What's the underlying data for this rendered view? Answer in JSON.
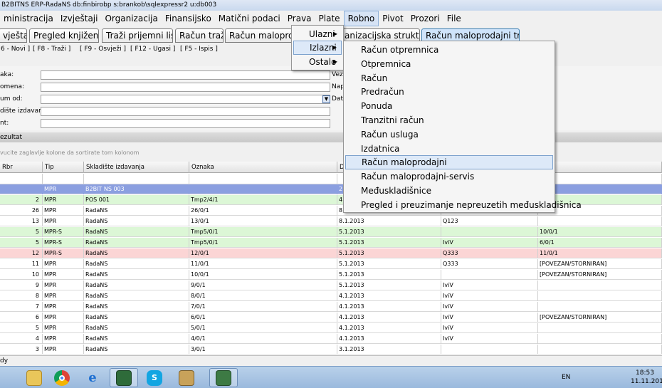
{
  "window": {
    "title": "B2BITNS ERP-RadaNS db:finbirobp s:brankob\\sqlexpressr2 u:db003"
  },
  "menubar": [
    "ministracija",
    "Izvještaji",
    "Organizacija",
    "Finansijsko",
    "Matični podaci",
    "Prava",
    "Plate",
    "Robno",
    "Pivot",
    "Prozori",
    "File"
  ],
  "tabs": [
    "vještaji",
    "Pregled knjiženja",
    "Traži prijemni list",
    "Račun traži",
    "Račun maloprodaj",
    "anizacijska struktura",
    "Račun maloprodajni traži"
  ],
  "shortcuts": [
    "6 - Novi ]",
    "[ F8 - Traži ]",
    "[ F9 - Osvježi ]",
    "[ F12 - Ugasi ]",
    "[ F5 - Ispis ]"
  ],
  "filter": {
    "labels": [
      "aka:",
      "omena:",
      "um od:",
      "dište izdavanja:",
      "nt:"
    ],
    "right_labels": [
      "Veza",
      "Napo",
      "Datu"
    ]
  },
  "section_label": "ezultat",
  "group_hint": "vucite zaglavlje kolone da sortirate tom kolonom",
  "grid": {
    "columns": [
      "Rbr",
      "Tip",
      "Skladište izdavanja",
      "Oznaka",
      "D",
      "",
      ""
    ],
    "rows": [
      {
        "rbr": "",
        "tip": "MPR",
        "skl": "B2BIT NS 003",
        "ozn": "",
        "dat": "2",
        "c6": "",
        "c7": "",
        "style": "sel"
      },
      {
        "rbr": "2",
        "tip": "MPR",
        "skl": "POS 001",
        "ozn": "Tmp2/4/1",
        "dat": "4",
        "c6": "",
        "c7": "",
        "style": "green"
      },
      {
        "rbr": "26",
        "tip": "MPR",
        "skl": "RadaNS",
        "ozn": "26/0/1",
        "dat": "8",
        "c6": "",
        "c7": "",
        "style": ""
      },
      {
        "rbr": "13",
        "tip": "MPR",
        "skl": "RadaNS",
        "ozn": "13/0/1",
        "dat": "8.1.2013",
        "c6": "Q123",
        "c7": "",
        "style": ""
      },
      {
        "rbr": "5",
        "tip": "MPR-S",
        "skl": "RadaNS",
        "ozn": "Tmp5/0/1",
        "dat": "5.1.2013",
        "c6": "",
        "c7": "10/0/1",
        "style": "green"
      },
      {
        "rbr": "5",
        "tip": "MPR-S",
        "skl": "RadaNS",
        "ozn": "Tmp5/0/1",
        "dat": "5.1.2013",
        "c6": "IviV",
        "c7": "6/0/1",
        "style": "green"
      },
      {
        "rbr": "12",
        "tip": "MPR-S",
        "skl": "RadaNS",
        "ozn": "12/0/1",
        "dat": "5.1.2013",
        "c6": "Q333",
        "c7": "11/0/1",
        "style": "red"
      },
      {
        "rbr": "11",
        "tip": "MPR",
        "skl": "RadaNS",
        "ozn": "11/0/1",
        "dat": "5.1.2013",
        "c6": "Q333",
        "c7": "[POVEZAN/STORNIRAN]",
        "style": ""
      },
      {
        "rbr": "10",
        "tip": "MPR",
        "skl": "RadaNS",
        "ozn": "10/0/1",
        "dat": "5.1.2013",
        "c6": "",
        "c7": "[POVEZAN/STORNIRAN]",
        "style": ""
      },
      {
        "rbr": "9",
        "tip": "MPR",
        "skl": "RadaNS",
        "ozn": "9/0/1",
        "dat": "5.1.2013",
        "c6": "IviV",
        "c7": "",
        "style": ""
      },
      {
        "rbr": "8",
        "tip": "MPR",
        "skl": "RadaNS",
        "ozn": "8/0/1",
        "dat": "4.1.2013",
        "c6": "IviV",
        "c7": "",
        "style": ""
      },
      {
        "rbr": "7",
        "tip": "MPR",
        "skl": "RadaNS",
        "ozn": "7/0/1",
        "dat": "4.1.2013",
        "c6": "IviV",
        "c7": "",
        "style": ""
      },
      {
        "rbr": "6",
        "tip": "MPR",
        "skl": "RadaNS",
        "ozn": "6/0/1",
        "dat": "4.1.2013",
        "c6": "IviV",
        "c7": "[POVEZAN/STORNIRAN]",
        "style": ""
      },
      {
        "rbr": "5",
        "tip": "MPR",
        "skl": "RadaNS",
        "ozn": "5/0/1",
        "dat": "4.1.2013",
        "c6": "IviV",
        "c7": "",
        "style": ""
      },
      {
        "rbr": "4",
        "tip": "MPR",
        "skl": "RadaNS",
        "ozn": "4/0/1",
        "dat": "4.1.2013",
        "c6": "IviV",
        "c7": "",
        "style": ""
      },
      {
        "rbr": "3",
        "tip": "MPR",
        "skl": "RadaNS",
        "ozn": "3/0/1",
        "dat": "3.1.2013",
        "c6": "",
        "c7": "",
        "style": ""
      }
    ]
  },
  "status": "dy",
  "robno_menu": [
    "Ulazni",
    "Izlazni",
    "Ostalo"
  ],
  "izlazni_menu": [
    "Račun otpremnica",
    "Otpremnica",
    "Račun",
    "Predračun",
    "Ponuda",
    "Tranzitni račun",
    "Račun usluga",
    "Izdatnica",
    "Račun maloprodajni",
    "Račun maloprodajni-servis",
    "Međuskladišnice",
    "Pregled i preuzimanje nepreuzetih međuskladišnica"
  ],
  "taskbar": {
    "icons": [
      "folder-icon",
      "chrome-icon",
      "ie-icon",
      "erp-icon",
      "skype-icon",
      "tools-icon",
      "app-icon"
    ],
    "lang": "EN",
    "time": "18:53",
    "date": "11.11.201"
  }
}
